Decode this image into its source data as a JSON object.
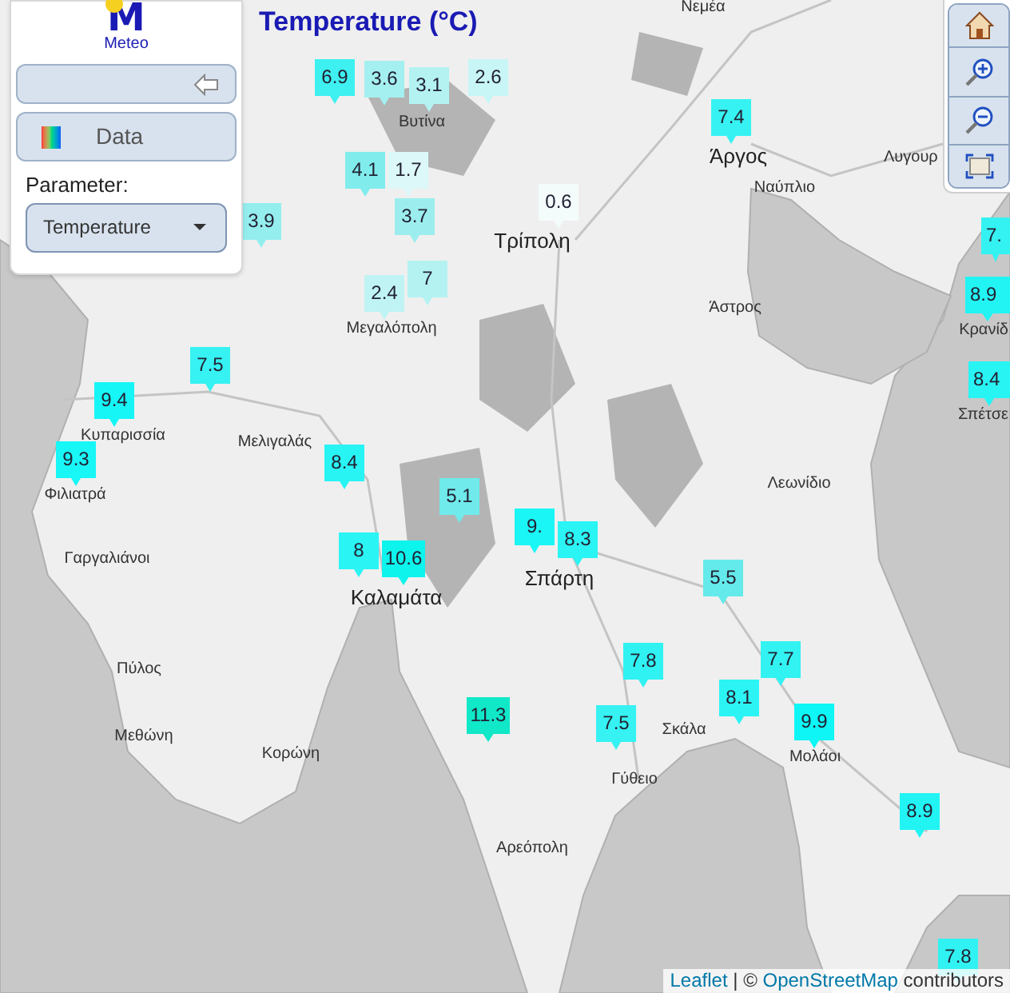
{
  "title": "Temperature (°C)",
  "logo": {
    "mark": "M",
    "text": "Meteo"
  },
  "panel": {
    "data_button": "Data",
    "parameter_label": "Parameter:",
    "parameter_select": "Temperature"
  },
  "map_labels": [
    {
      "text": "Νεμέα",
      "kind": "town"
    },
    {
      "text": "Βυτίνα",
      "kind": "town"
    },
    {
      "text": "Άργος",
      "kind": "city"
    },
    {
      "text": "Λυγουρ",
      "kind": "town"
    },
    {
      "text": "Ναύπλιο",
      "kind": "town"
    },
    {
      "text": "Τρίπολη",
      "kind": "city"
    },
    {
      "text": "Μεγαλόπολη",
      "kind": "town"
    },
    {
      "text": "Άστρος",
      "kind": "town"
    },
    {
      "text": "Κρανίδ",
      "kind": "town"
    },
    {
      "text": "Κυπαρισσία",
      "kind": "town"
    },
    {
      "text": "Σπέτσε",
      "kind": "town"
    },
    {
      "text": "Μελιγαλάς",
      "kind": "town"
    },
    {
      "text": "Φιλιατρά",
      "kind": "town"
    },
    {
      "text": "Λεωνίδιο",
      "kind": "town"
    },
    {
      "text": "Σπάρτη",
      "kind": "city"
    },
    {
      "text": "Γαργαλιάνοι",
      "kind": "town"
    },
    {
      "text": "Καλαμάτα",
      "kind": "city"
    },
    {
      "text": "Πύλος",
      "kind": "town"
    },
    {
      "text": "Σκάλα",
      "kind": "town"
    },
    {
      "text": "Μεθώνη",
      "kind": "town"
    },
    {
      "text": "Κορώνη",
      "kind": "town"
    },
    {
      "text": "Μολάοι",
      "kind": "town"
    },
    {
      "text": "Γύθειο",
      "kind": "town"
    },
    {
      "text": "Αρεόπολη",
      "kind": "town"
    }
  ],
  "markers": [
    {
      "value": "6.9",
      "color": "#3ef0f0"
    },
    {
      "value": "3.6",
      "color": "#a4f0f0"
    },
    {
      "value": "3.1",
      "color": "#b4f2f2"
    },
    {
      "value": "2.6",
      "color": "#c8f6f6"
    },
    {
      "value": "7.4",
      "color": "#36f2f2"
    },
    {
      "value": "4.1",
      "color": "#80ecec"
    },
    {
      "value": "1.7",
      "color": "#dcf8f8"
    },
    {
      "value": "3.9",
      "color": "#94eeee"
    },
    {
      "value": "3.7",
      "color": "#9ceeee"
    },
    {
      "value": "0.6",
      "color": "#f4fbfb"
    },
    {
      "value": "7.",
      "color": "#34f2f2"
    },
    {
      "value": "2.4",
      "color": "#c0f4f4"
    },
    {
      "value": "7",
      "color": "#b4f2f2"
    },
    {
      "value": "8.9",
      "color": "#22f4f4"
    },
    {
      "value": "7.5",
      "color": "#36f2f2"
    },
    {
      "value": "8.4",
      "color": "#28f4f4"
    },
    {
      "value": "9.4",
      "color": "#16f6f6"
    },
    {
      "value": "9.3",
      "color": "#18f6f6"
    },
    {
      "value": "8.4",
      "color": "#28f4f4"
    },
    {
      "value": "5.1",
      "color": "#70eaea"
    },
    {
      "value": "9.",
      "color": "#1af6f6"
    },
    {
      "value": "8.3",
      "color": "#2af4f4"
    },
    {
      "value": "8",
      "color": "#2af4f4"
    },
    {
      "value": "10.6",
      "color": "#0cf4ec"
    },
    {
      "value": "5.5",
      "color": "#64eaea"
    },
    {
      "value": "7.8",
      "color": "#30f2f2"
    },
    {
      "value": "7.7",
      "color": "#32f2f2"
    },
    {
      "value": "8.1",
      "color": "#2cf4f4"
    },
    {
      "value": "11.3",
      "color": "#10e8c8"
    },
    {
      "value": "7.5",
      "color": "#36f2f2"
    },
    {
      "value": "9.9",
      "color": "#0ef6f6"
    },
    {
      "value": "8.9",
      "color": "#22f4f4"
    },
    {
      "value": "7.8",
      "color": "#30f2f2"
    }
  ],
  "attribution": {
    "link_1": "Leaflet",
    "separator": "| ©",
    "link_2": "OpenStreetMap",
    "suffix": "contributors"
  }
}
